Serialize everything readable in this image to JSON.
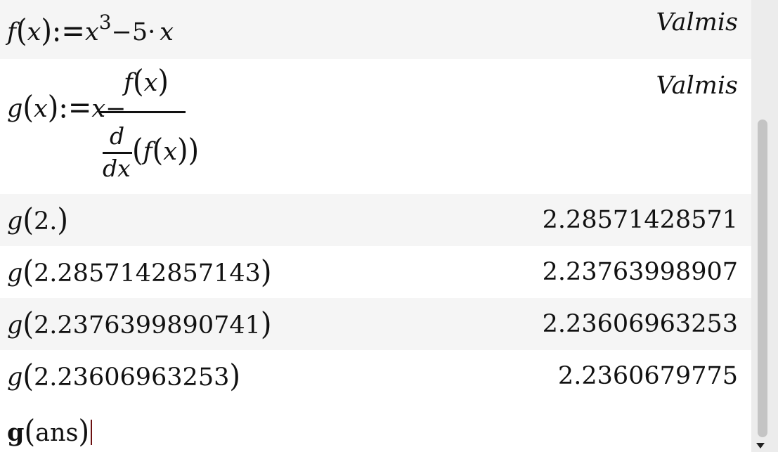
{
  "rows": [
    {
      "kind": "define",
      "expr": {
        "f": "f",
        "x": "x",
        "assign": "):=",
        "x2": "x",
        "exp": "3",
        "rest": "−5·",
        "x3": "x"
      },
      "result": "Valmis"
    },
    {
      "kind": "define",
      "expr": {
        "g": "g",
        "x": "x",
        "assign": "):=",
        "x2": "x",
        "minus": "−",
        "num_f": "f",
        "num_x": "x",
        "d": "d",
        "dx": "dx",
        "den_f": "f",
        "den_x": "x"
      },
      "result": "Valmis"
    },
    {
      "kind": "eval",
      "func": "g",
      "arg": "2.",
      "result": "2.28571428571"
    },
    {
      "kind": "eval",
      "func": "g",
      "arg": "2.2857142857143",
      "result": "2.23763998907"
    },
    {
      "kind": "eval",
      "func": "g",
      "arg": "2.2376399890741",
      "result": "2.23606963253"
    },
    {
      "kind": "eval",
      "func": "g",
      "arg": "2.23606963253",
      "result": "2.2360679775"
    }
  ],
  "input": {
    "func": "g",
    "arg": "ans"
  }
}
